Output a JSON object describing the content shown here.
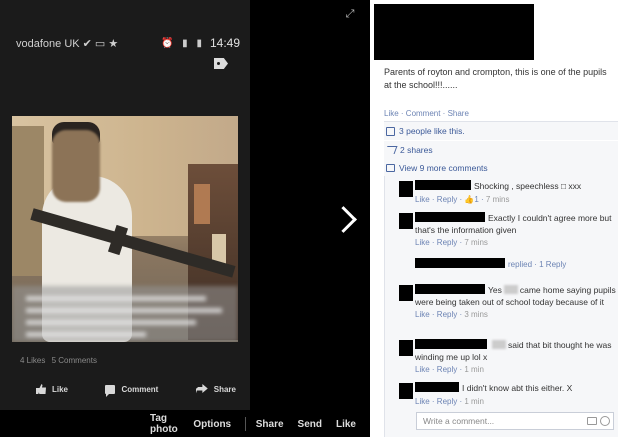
{
  "status_bar": {
    "carrier": "vodafone UK ✔ ▭ ★",
    "signal_icons": "⏰ ▮ ▮",
    "time": "14:49"
  },
  "photo_post": {
    "counts": {
      "likes": "4 Likes",
      "comments": "5 Comments"
    },
    "actions": {
      "like": "Like",
      "comment": "Comment",
      "share": "Share"
    }
  },
  "viewer_bar": {
    "tag_photo": "Tag photo",
    "options": "Options",
    "share": "Share",
    "send": "Send",
    "like": "Like"
  },
  "post": {
    "text": "Parents of royton and crompton, this is one of the pupils at the school!!!......",
    "links": "Like · Comment · Share",
    "likes_info": "3 people like this.",
    "shares_info": "2 shares",
    "more_comments": "View 9 more comments"
  },
  "comments": [
    {
      "text": "Shocking , speechless □ xxx",
      "like": "Like",
      "reply": "Reply",
      "likes": "1",
      "time": "7 mins"
    },
    {
      "text": "Exactly I couldn't agree more but that's the information given",
      "like": "Like",
      "reply": "Reply",
      "time": "7 mins"
    },
    {
      "text": "replied · 1 Reply"
    },
    {
      "text_a": "Yes",
      "text_b": "came home saying pupils were being taken out of school today because of it",
      "like": "Like",
      "reply": "Reply",
      "time": "3 mins"
    },
    {
      "text_a": "said that bit thought he was winding me up lol x",
      "like": "Like",
      "reply": "Reply",
      "time": "1 min"
    },
    {
      "text": "I didn't know abt this either. X",
      "like": "Like",
      "reply": "Reply",
      "time": "1 min"
    }
  ],
  "write_comment": {
    "placeholder": "Write a comment..."
  }
}
